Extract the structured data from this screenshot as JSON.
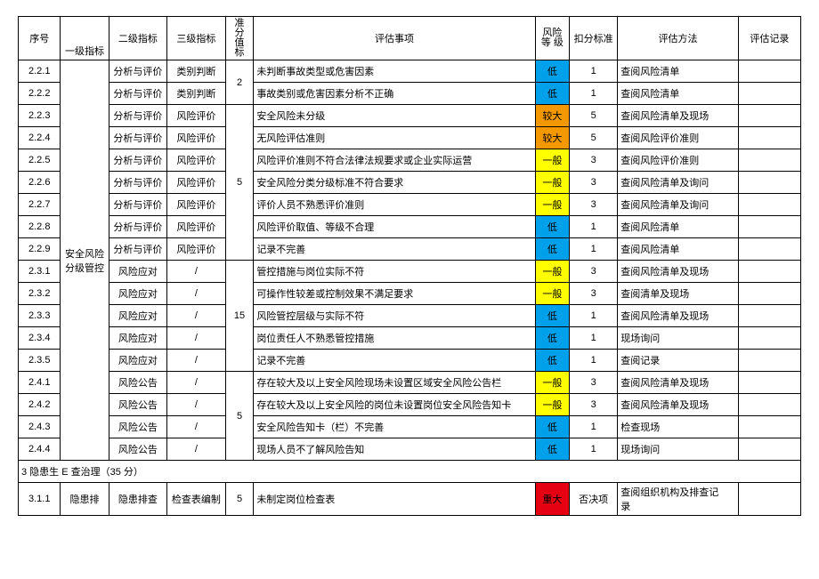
{
  "headers": {
    "seq": "序号",
    "lv1": "一级指标",
    "lv2": "二级指标",
    "lv3": "三级指标",
    "std": "准\n分\n值\n标",
    "item": "评估事项",
    "risk": "风险等\n级",
    "deduct": "扣分标准",
    "method": "评估方法",
    "log": "评估记录"
  },
  "vert": {
    "cat2": "安全风险\n分级管控",
    "cat3": "隐患排"
  },
  "rows": [
    {
      "seq": "2.2.1",
      "l2": "分析与评价",
      "l3": "类别判断",
      "std": "2",
      "stdspan": 2,
      "item": "未判断事故类型或危害因素",
      "rk": "低",
      "rc": "low",
      "d": "1",
      "m": "查阅风险清单"
    },
    {
      "seq": "2.2.2",
      "l2": "分析与评价",
      "l3": "类别判断",
      "item": "事故类别或危害因素分析不正确",
      "rk": "低",
      "rc": "low",
      "d": "1",
      "m": "查阅风险清单"
    },
    {
      "seq": "2.2.3",
      "l2": "分析与评价",
      "l3": "风险评价",
      "std": "5",
      "stdspan": 7,
      "item": "安全风险未分级",
      "rk": "较大",
      "rc": "maj",
      "d": "5",
      "m": "查阅风险清单及现场"
    },
    {
      "seq": "2.2.4",
      "l2": "分析与评价",
      "l3": "风险评价",
      "item": "无风险评估准则",
      "rk": "较大",
      "rc": "maj",
      "d": "5",
      "m": "查阅风险评价准则"
    },
    {
      "seq": "2.2.5",
      "l2": "分析与评价",
      "l3": "风险评价",
      "item": "风险评价准则不符合法律法规要求或企业实际运营",
      "rk": "一般",
      "rc": "gen",
      "d": "3",
      "m": "查阅风险评价准则"
    },
    {
      "seq": "2.2.6",
      "l2": "分析与评价",
      "l3": "风险评价",
      "item": "安全风险分类分级标准不符合要求",
      "rk": "一般",
      "rc": "gen",
      "d": "3",
      "m": "查阅风险清单及询问"
    },
    {
      "seq": "2.2.7",
      "l2": "分析与评价",
      "l3": "风险评价",
      "item": "评价人员不熟悉评价准则",
      "rk": "一般",
      "rc": "gen",
      "d": "3",
      "m": "查阅风险清单及询问"
    },
    {
      "seq": "2.2.8",
      "l2": "分析与评价",
      "l3": "风险评价",
      "item": "风险评价取值、等级不合理",
      "rk": "低",
      "rc": "low",
      "d": "1",
      "m": "查阅风险清单"
    },
    {
      "seq": "2.2.9",
      "l2": "分析与评价",
      "l3": "风险评价",
      "item": "记录不完善",
      "rk": "低",
      "rc": "low",
      "d": "1",
      "m": "查阅风险清单"
    },
    {
      "seq": "2.3.1",
      "l2": "风险应对",
      "l3": "/",
      "std": "15",
      "stdspan": 5,
      "item": "管控措施与岗位实际不符",
      "rk": "一般",
      "rc": "gen",
      "d": "3",
      "m": "查阅风险清单及现场"
    },
    {
      "seq": "2.3.2",
      "l2": "风险应对",
      "l3": "/",
      "item": "可操作性较差或控制效果不满足要求",
      "rk": "一般",
      "rc": "gen",
      "d": "3",
      "m": "查阅清单及现场"
    },
    {
      "seq": "2.3.3",
      "l2": "风险应对",
      "l3": "/",
      "item": "风险管控层级与实际不符",
      "rk": "低",
      "rc": "low",
      "d": "1",
      "m": "查阅风险清单及现场"
    },
    {
      "seq": "2.3.4",
      "l2": "风险应对",
      "l3": "/",
      "item": "岗位责任人不熟悉管控措施",
      "rk": "低",
      "rc": "low",
      "d": "1",
      "m": "现场询问"
    },
    {
      "seq": "2.3.5",
      "l2": "风险应对",
      "l3": "/",
      "item": "记录不完善",
      "rk": "低",
      "rc": "low",
      "d": "1",
      "m": "查阅记录"
    },
    {
      "seq": "2.4.1",
      "l2": "风险公告",
      "l3": "/",
      "std": "5",
      "stdspan": 4,
      "item": "存在较大及以上安全风险现场未设置区域安全风险公告栏",
      "rk": "一般",
      "rc": "gen",
      "d": "3",
      "m": "查阅风险清单及现场"
    },
    {
      "seq": "2.4.2",
      "l2": "风险公告",
      "l3": "/",
      "item": "存在较大及以上安全风险的岗位未设置岗位安全风险告知卡",
      "rk": "一般",
      "rc": "gen",
      "d": "3",
      "m": "查阅风险清单及现场"
    },
    {
      "seq": "2.4.3",
      "l2": "风险公告",
      "l3": "/",
      "item": "安全风险告知卡（栏）不完善",
      "rk": "低",
      "rc": "low",
      "d": "1",
      "m": "检查现场"
    },
    {
      "seq": "2.4.4",
      "l2": "风险公告",
      "l3": "/",
      "item": "现场人员不了解风险告知",
      "rk": "低",
      "rc": "low",
      "d": "1",
      "m": "现场询问"
    }
  ],
  "section": {
    "label": "3 隐患生 E 查治理（35 分）"
  },
  "row311": {
    "seq": "3.1.1",
    "l2": "隐患排查",
    "l3": "检查表编制",
    "std": "5",
    "item": "未制定岗位检查表",
    "rk": "重大",
    "d": "否决项",
    "m": "查阅组织机构及排查记\n录"
  }
}
